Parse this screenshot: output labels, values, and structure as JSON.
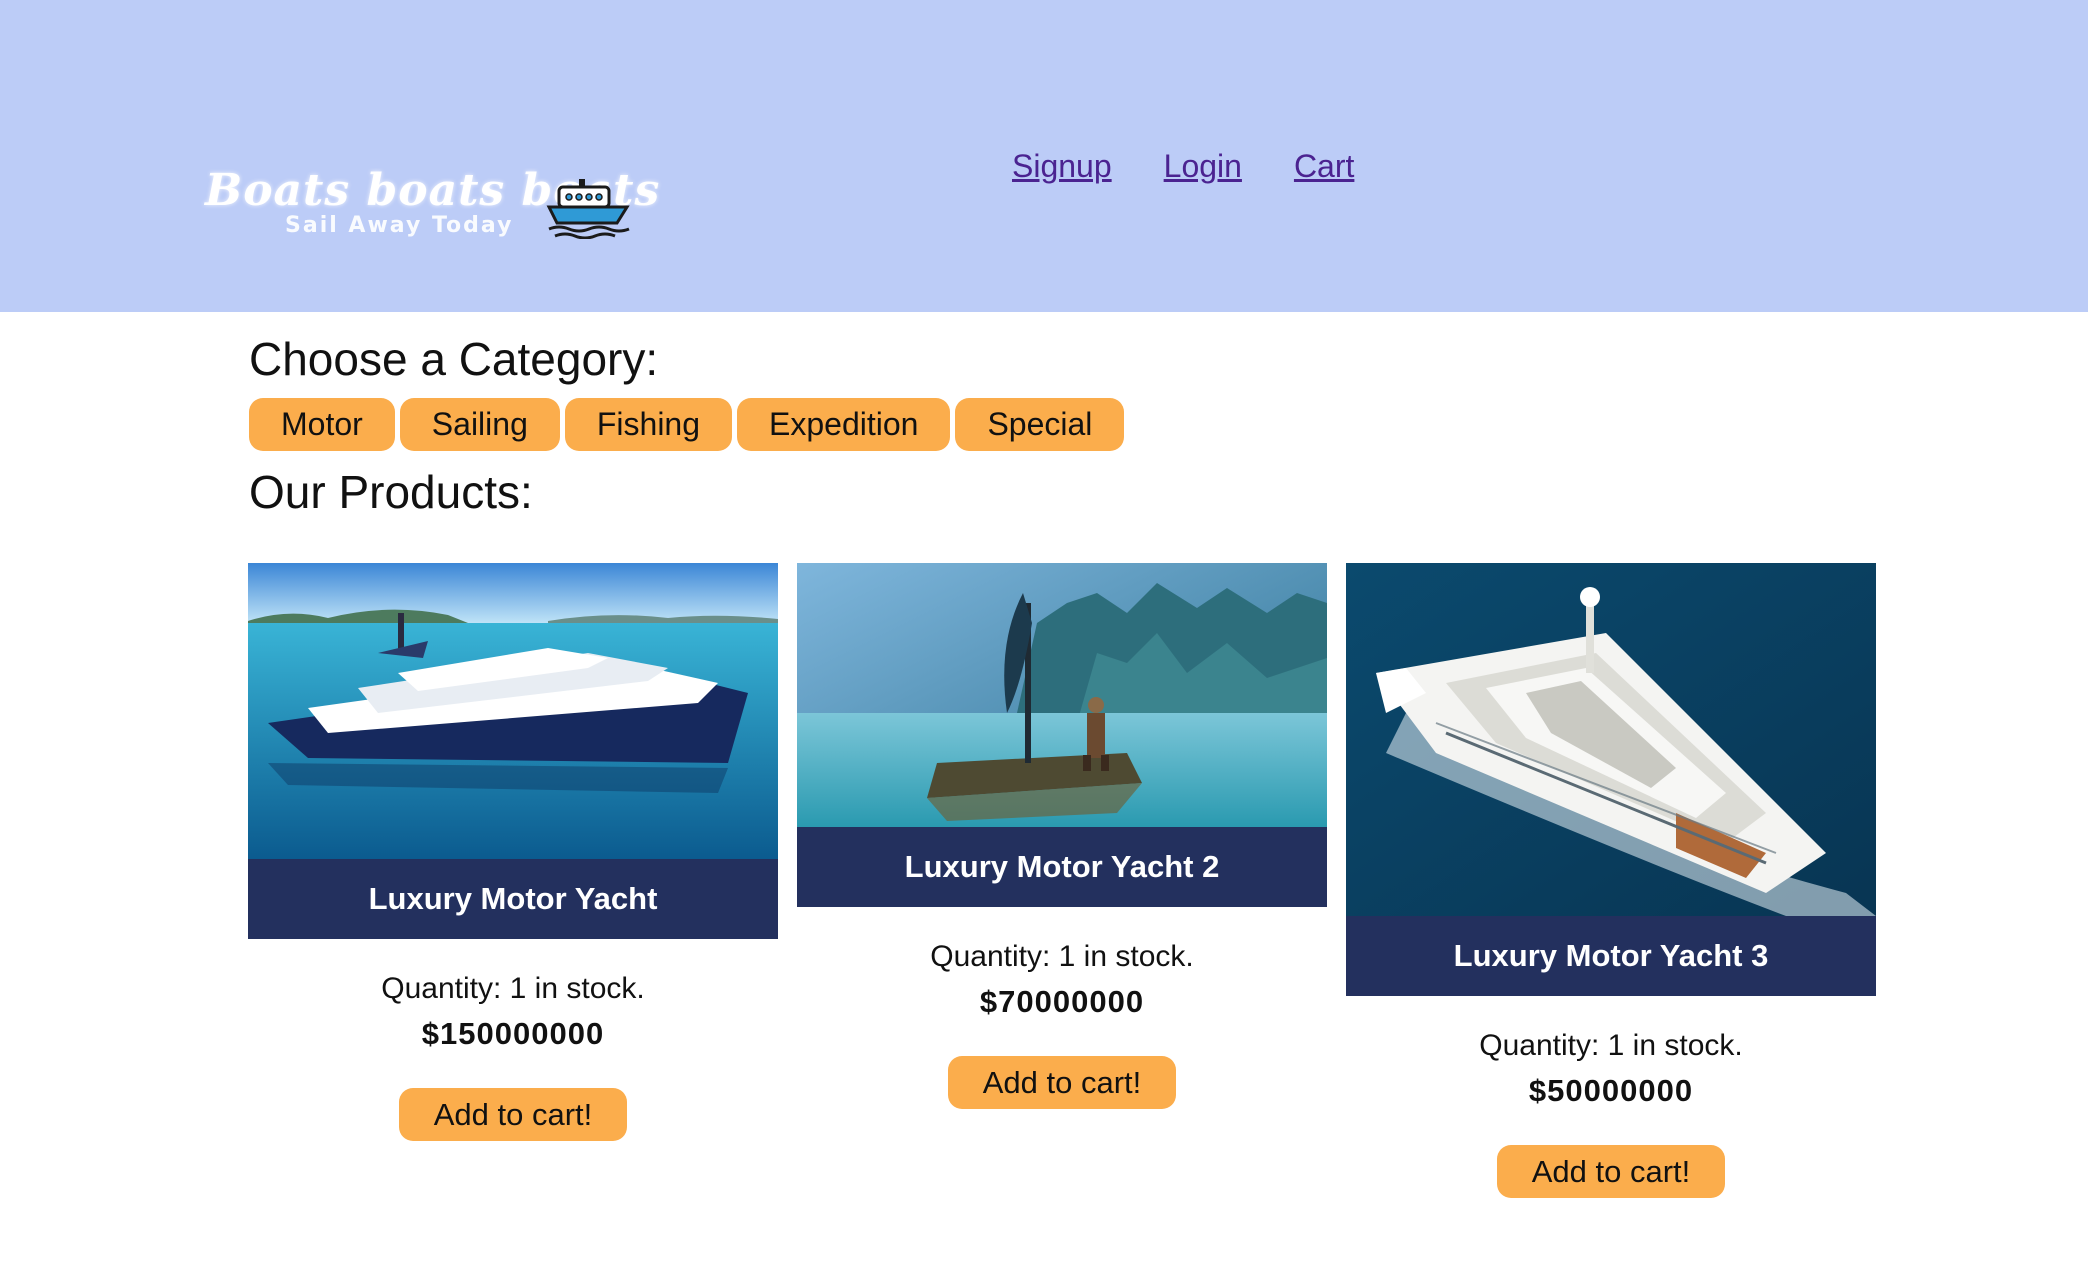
{
  "header": {
    "logo_title": "Boats boats boats",
    "logo_tagline": "Sail Away Today",
    "logo_icon": "boat-icon",
    "background_color": "#bcccf7",
    "nav": [
      {
        "label": "Signup"
      },
      {
        "label": "Login"
      },
      {
        "label": "Cart"
      }
    ]
  },
  "category_section": {
    "heading": "Choose a Category:",
    "categories": [
      {
        "label": "Motor"
      },
      {
        "label": "Sailing"
      },
      {
        "label": "Fishing"
      },
      {
        "label": "Expedition"
      },
      {
        "label": "Special"
      }
    ]
  },
  "products_section": {
    "heading": "Our Products:",
    "products": [
      {
        "name": "Luxury Motor Yacht",
        "quantity": "Quantity: 1 in stock.",
        "price": "$150000000",
        "button_label": "Add to cart!",
        "image": "luxury-yacht-photo"
      },
      {
        "name": "Luxury Motor Yacht 2",
        "quantity": "Quantity: 1 in stock.",
        "price": "$70000000",
        "button_label": "Add to cart!",
        "image": "viking-raft-photo"
      },
      {
        "name": "Luxury Motor Yacht 3",
        "quantity": "Quantity: 1 in stock.",
        "price": "$50000000",
        "button_label": "Add to cart!",
        "image": "white-superyacht-photo"
      }
    ]
  },
  "colors": {
    "accent": "#fbad4c",
    "product_bar": "#23305e",
    "link": "#4b2391"
  }
}
